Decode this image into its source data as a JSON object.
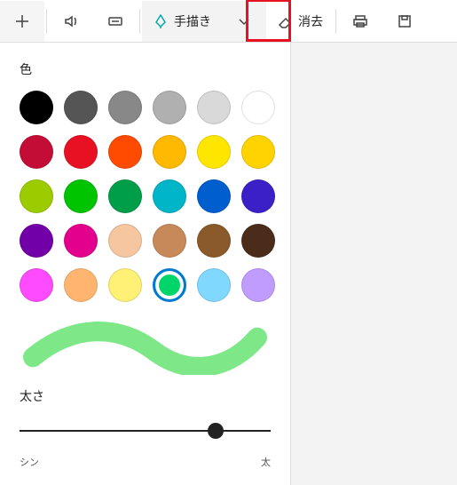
{
  "toolbar": {
    "draw_label": "手描き",
    "erase_label": "消去"
  },
  "panel": {
    "color_label": "色",
    "thickness_label": "太さ",
    "slider_min_label": "シン",
    "slider_max_label": "太",
    "slider_value_pct": 78,
    "preview_color": "#7ee787",
    "colors": [
      "#000000",
      "#555555",
      "#888888",
      "#b0b0b0",
      "#d9d9d9",
      "#ffffff",
      "#c40d36",
      "#e81123",
      "#ff4b00",
      "#ffb900",
      "#ffe600",
      "#ffd300",
      "#9ccc00",
      "#00c400",
      "#009e49",
      "#00b5c7",
      "#005ecf",
      "#3b20c7",
      "#7200a8",
      "#e3008c",
      "#f5c6a0",
      "#c8895a",
      "#8b5a2b",
      "#4b2c1a",
      "#ff4bff",
      "#ffb570",
      "#fff176",
      "#00d56a",
      "#80d8ff",
      "#c19cff"
    ],
    "selected_color_index": 27
  }
}
